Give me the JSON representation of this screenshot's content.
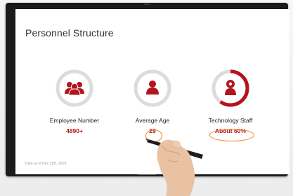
{
  "slide": {
    "title": "Personnel Structure",
    "footer_note": "Data as of Dec 31th, 2019",
    "stats": [
      {
        "label": "Employee Number",
        "value": "4890+",
        "icon": "people-icon",
        "progress": 1.0
      },
      {
        "label": "Average Age",
        "value": "29",
        "icon": "person-icon",
        "progress": 1.0
      },
      {
        "label": "Technology Staff",
        "value": "About 60%",
        "icon": "lightbulb-person-icon",
        "progress": 0.6
      }
    ]
  },
  "colors": {
    "accent": "#b3151d",
    "ring_track": "#dcdcdc",
    "highlight": "#e9861c"
  }
}
